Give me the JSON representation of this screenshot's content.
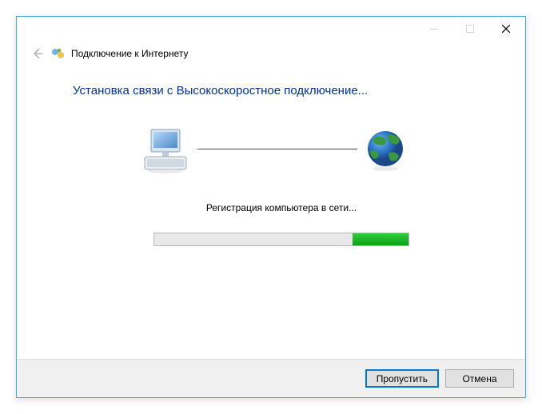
{
  "titlebar": {
    "minimize": "—",
    "maximize": "☐",
    "close": "✕"
  },
  "header": {
    "back_arrow": "←",
    "title": "Подключение к Интернету"
  },
  "main": {
    "heading": "Установка связи с Высокоскоростное подключение...",
    "status": "Регистрация компьютера в сети..."
  },
  "progress": {
    "percent": 78
  },
  "buttons": {
    "skip": "Пропустить",
    "cancel": "Отмена"
  }
}
